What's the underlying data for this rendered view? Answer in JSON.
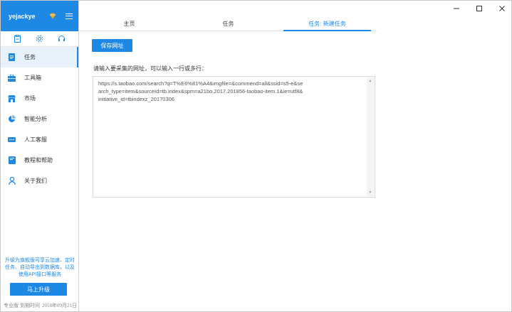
{
  "sidebar": {
    "username": "yejackye",
    "nav": [
      {
        "label": "任务",
        "icon": "task-icon",
        "active": true
      },
      {
        "label": "工具箱",
        "icon": "toolbox-icon",
        "active": false
      },
      {
        "label": "市场",
        "icon": "market-icon",
        "active": false
      },
      {
        "label": "智能分析",
        "icon": "pie-chart-icon",
        "active": false
      },
      {
        "label": "人工客服",
        "icon": "chat-icon",
        "active": false
      },
      {
        "label": "教程和帮助",
        "icon": "book-icon",
        "active": false
      },
      {
        "label": "关于我们",
        "icon": "person-icon",
        "active": false
      }
    ],
    "promo_text": "升级为旗舰版可享云加速、定时任务、自动导出到数据库，以及使用API接口等服务",
    "upgrade_label": "马上升级",
    "edition": "专业版",
    "expiry_label": "到期时间",
    "expiry_date": "2018年09月21日"
  },
  "tabs": [
    {
      "label": "主页",
      "active": false
    },
    {
      "label": "任务",
      "active": false
    },
    {
      "label": "任务: 新建任务",
      "active": true
    }
  ],
  "main": {
    "save_label": "保存网址",
    "prompt": "请输入要采集的网址，可以输入一行或多行：",
    "url_value": "https://s.taobao.com/search?q=T%E6%81%A4&imgfile=&commend=all&ssid=s5-e&search_type=item&sourceId=tb.index&spm=a21bo.2017.201856-taobao-item.1&ie=utf8&initiative_id=tbindexz_20170306"
  },
  "colors": {
    "accent": "#1e88e5",
    "active_bg": "#e8f2fc"
  }
}
